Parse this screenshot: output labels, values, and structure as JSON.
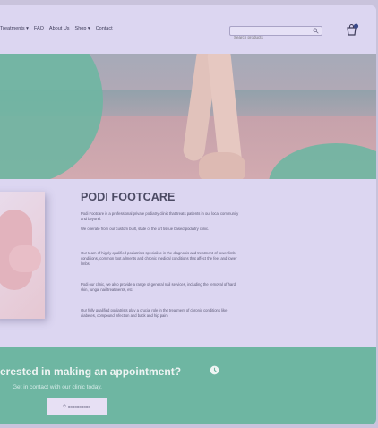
{
  "nav": {
    "items": [
      "Treatments ▾",
      "FAQ",
      "About Us",
      "Shop ▾",
      "Contact"
    ]
  },
  "search": {
    "placeholder": "Search products"
  },
  "icons": {
    "search": "search-icon",
    "cart": "cart-icon",
    "clock": "clock-icon",
    "phone": "phone-icon"
  },
  "cart": {
    "badge_color": "#3b4a8a"
  },
  "main": {
    "title": "PODI FOOTCARE",
    "paragraphs": [
      "Podi Footcare is a professional private podiatry clinic that treats patients in our local community and beyond.",
      "We operate from our custom built, state of the art tissue based podiatry clinic.",
      "Our team of highly qualified podiatrists specialise in the diagnosis and treatment of lower limb conditions, common foot ailments and chronic medical conditions that affect the feet and lower limbs.",
      "Podi our clinic, we also provide a range of general nail services, including the removal of hard skin, fungal nail treatments, etc.",
      "Our fully qualified podiatrists play a crucial role in the treatment of chronic conditions like diabetes, compound infection and back and hip pain."
    ]
  },
  "appointment": {
    "title": "erested in making an appointment?",
    "subtitle": "Get in contact with our clinic today.",
    "button": "0000000000"
  },
  "colors": {
    "accent": "#6eb6a2",
    "background": "#dcd6f1",
    "text": "#4b4a63"
  }
}
